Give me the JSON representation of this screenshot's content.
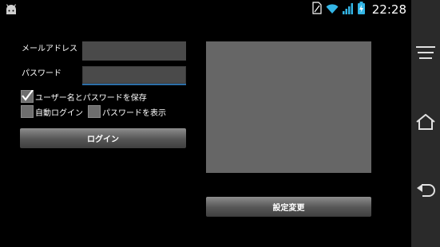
{
  "status_bar": {
    "time": "22:28"
  },
  "form": {
    "email_label": "メールアドレス",
    "email_value": "",
    "password_label": "パスワード",
    "password_value": "",
    "save_credentials_label": "ユーザー名とパスワードを保存",
    "save_credentials_checked": true,
    "auto_login_label": "自動ログイン",
    "auto_login_checked": false,
    "show_password_label": "パスワードを表示",
    "show_password_checked": false,
    "login_button": "ログイン"
  },
  "settings_button": "設定変更",
  "colors": {
    "background": "#000000",
    "field": "#4a4a4a",
    "focus_accent": "#2d6fa8",
    "preview": "#666666"
  },
  "icons": [
    "android-icon",
    "sim-icon",
    "wifi-icon",
    "signal-icon",
    "battery-icon",
    "menu-icon",
    "home-icon",
    "back-icon",
    "check-icon"
  ]
}
